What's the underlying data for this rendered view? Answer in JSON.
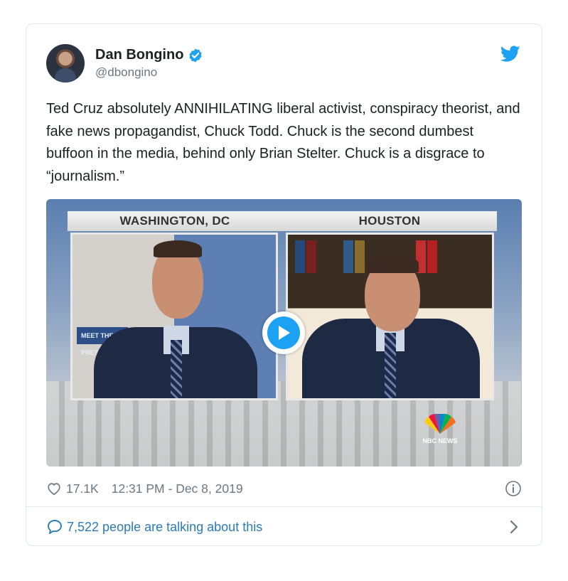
{
  "tweet": {
    "display_name": "Dan Bongino",
    "handle": "@dbongino",
    "verified_icon": "verified-badge-icon",
    "platform_icon": "twitter-bird-icon",
    "text": "Ted Cruz absolutely ANNIHILATING liberal activist, conspiracy theorist, and fake news propagandist, Chuck Todd. Chuck is the second dumbest buffoon in the media, behind only Brian Stelter. Chuck is a disgrace to “journalism.”",
    "accent_color": "#1da1f2",
    "link_color": "#2b7bb9"
  },
  "media": {
    "left_location": "WASHINGTON, DC",
    "right_location": "HOUSTON",
    "sign_text": "MEET THE PRESS",
    "network_logo_text": "NBC NEWS",
    "play_icon": "play-icon"
  },
  "meta": {
    "likes": "17.1K",
    "timestamp": "12:31 PM - Dec 8, 2019",
    "like_icon": "heart-icon",
    "info_icon": "info-icon"
  },
  "footer": {
    "talking_text": "7,522 people are talking about this",
    "bubble_icon": "speech-bubble-icon",
    "chevron_icon": "chevron-right-icon"
  }
}
